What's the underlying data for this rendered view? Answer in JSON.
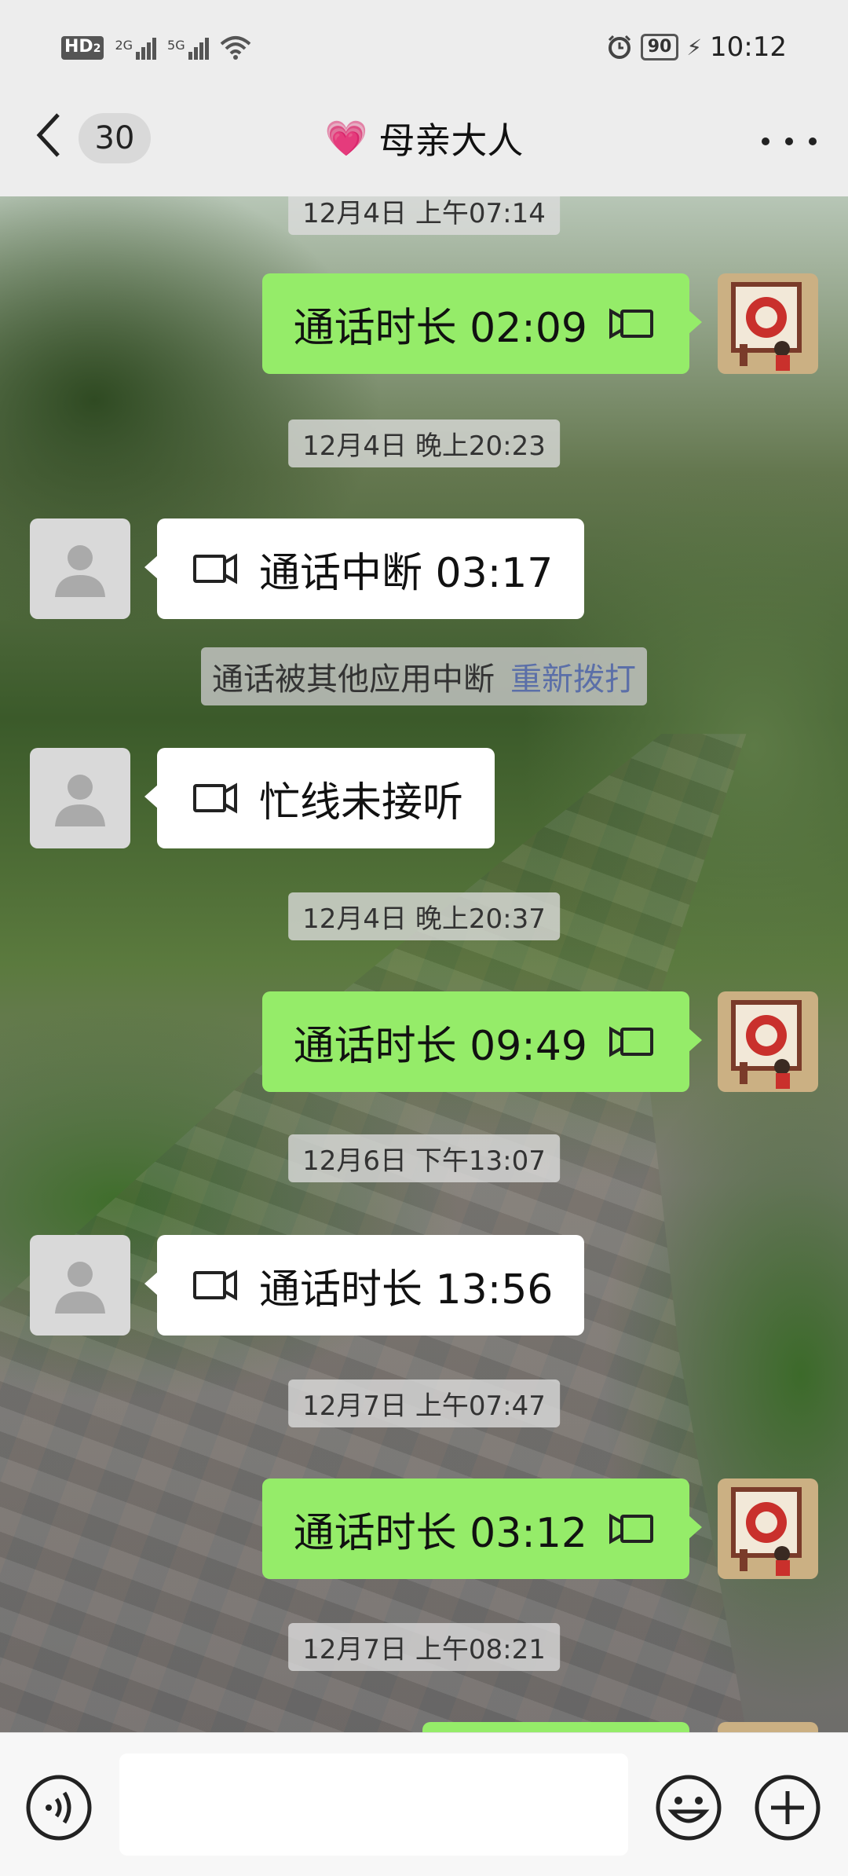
{
  "status_bar": {
    "network_badge": "HD",
    "network_badge_sub": "2",
    "sim1_label": "2G",
    "sim2_label": "5G",
    "battery": "90",
    "time": "10:12"
  },
  "nav": {
    "back_count": "30",
    "title": "母亲大人",
    "title_emoji": "💗"
  },
  "messages": [
    {
      "type": "timestamp",
      "text": "12月4日 上午07:14"
    },
    {
      "type": "call",
      "sender": "me",
      "text": "通话时长 02:09"
    },
    {
      "type": "timestamp",
      "text": "12月4日 晚上20:23"
    },
    {
      "type": "call",
      "sender": "them",
      "text": "通话中断 03:17"
    },
    {
      "type": "system",
      "text": "通话被其他应用中断",
      "link": "重新拨打"
    },
    {
      "type": "call",
      "sender": "them",
      "text": "忙线未接听"
    },
    {
      "type": "timestamp",
      "text": "12月4日 晚上20:37"
    },
    {
      "type": "call",
      "sender": "me",
      "text": "通话时长 09:49"
    },
    {
      "type": "timestamp",
      "text": "12月6日 下午13:07"
    },
    {
      "type": "call",
      "sender": "them",
      "text": "通话时长 13:56"
    },
    {
      "type": "timestamp",
      "text": "12月7日 上午07:47"
    },
    {
      "type": "call",
      "sender": "me",
      "text": "通话时长 03:12"
    },
    {
      "type": "timestamp",
      "text": "12月7日 上午08:21"
    }
  ],
  "colors": {
    "my_bubble": "#95ec69",
    "their_bubble": "#ffffff",
    "link": "#5b6fa8"
  },
  "icons": [
    "video-call-icon",
    "voice-input-icon",
    "emoji-icon",
    "plus-icon",
    "more-icon",
    "back-icon"
  ]
}
